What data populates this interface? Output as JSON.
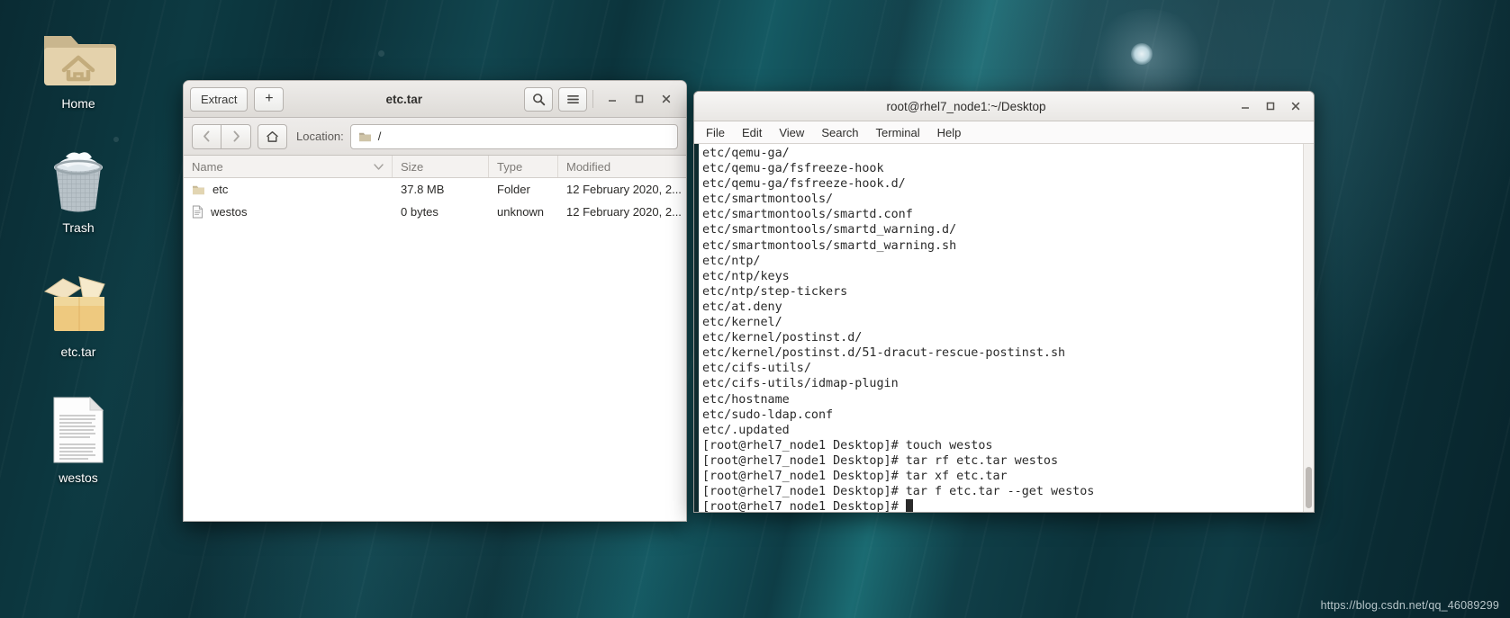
{
  "desktop": {
    "icons": [
      {
        "label": "Home",
        "icon": "home-folder-icon"
      },
      {
        "label": "Trash",
        "icon": "trash-bin-icon"
      },
      {
        "label": "etc.tar",
        "icon": "archive-box-icon"
      },
      {
        "label": "westos",
        "icon": "text-document-icon"
      }
    ],
    "watermark": "https://blog.csdn.net/qq_46089299"
  },
  "archive_manager": {
    "title": "etc.tar",
    "header": {
      "extract_label": "Extract",
      "add_label": "+",
      "search_icon": "search-icon",
      "menu_icon": "hamburger-menu-icon",
      "minimize_icon": "minimize-icon",
      "maximize_icon": "maximize-icon",
      "close_icon": "close-icon"
    },
    "toolbar": {
      "back_icon": "chevron-left-icon",
      "forward_icon": "chevron-right-icon",
      "home_icon": "home-icon",
      "location_label": "Location:",
      "location_value": "/",
      "folder_icon": "folder-icon"
    },
    "columns": [
      "Name",
      "Size",
      "Type",
      "Modified"
    ],
    "sort_indicator_icon": "sort-descending-icon",
    "rows": [
      {
        "icon": "folder-icon",
        "name": "etc",
        "size": "37.8 MB",
        "type": "Folder",
        "modified": "12 February 2020, 2..."
      },
      {
        "icon": "document-icon",
        "name": "westos",
        "size": "0 bytes",
        "type": "unknown",
        "modified": "12 February 2020, 2..."
      }
    ]
  },
  "terminal": {
    "title": "root@rhel7_node1:~/Desktop",
    "window_buttons": {
      "minimize_icon": "minimize-icon",
      "maximize_icon": "maximize-icon",
      "close_icon": "close-icon"
    },
    "menus": [
      "File",
      "Edit",
      "View",
      "Search",
      "Terminal",
      "Help"
    ],
    "lines": [
      "etc/qemu-ga/",
      "etc/qemu-ga/fsfreeze-hook",
      "etc/qemu-ga/fsfreeze-hook.d/",
      "etc/smartmontools/",
      "etc/smartmontools/smartd.conf",
      "etc/smartmontools/smartd_warning.d/",
      "etc/smartmontools/smartd_warning.sh",
      "etc/ntp/",
      "etc/ntp/keys",
      "etc/ntp/step-tickers",
      "etc/at.deny",
      "etc/kernel/",
      "etc/kernel/postinst.d/",
      "etc/kernel/postinst.d/51-dracut-rescue-postinst.sh",
      "etc/cifs-utils/",
      "etc/cifs-utils/idmap-plugin",
      "etc/hostname",
      "etc/sudo-ldap.conf",
      "etc/.updated",
      "[root@rhel7_node1 Desktop]# touch westos",
      "[root@rhel7_node1 Desktop]# tar rf etc.tar westos",
      "[root@rhel7_node1 Desktop]# tar xf etc.tar",
      "[root@rhel7_node1 Desktop]# tar f etc.tar --get westos"
    ],
    "prompt": "[root@rhel7_node1 Desktop]# "
  }
}
